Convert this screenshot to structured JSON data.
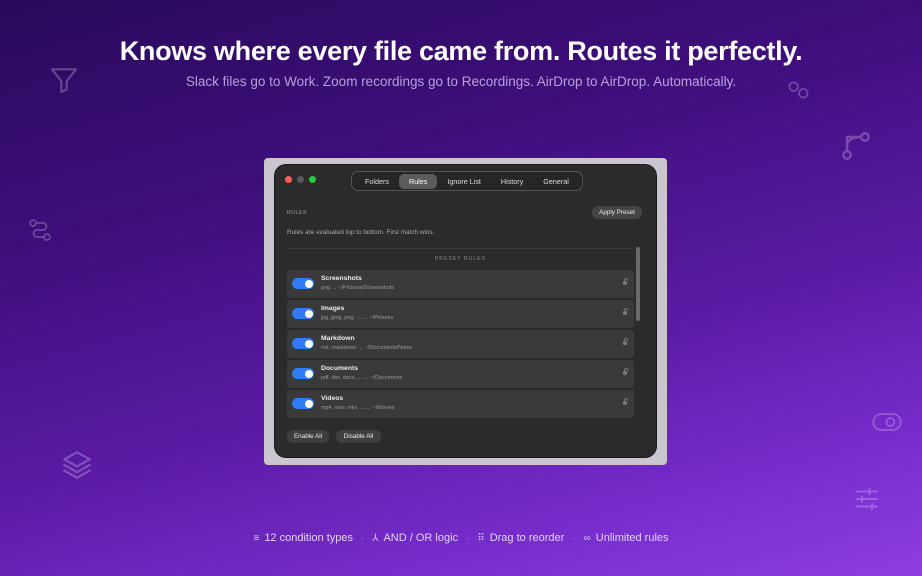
{
  "hero": {
    "title": "Knows where every file came from. Routes it perfectly.",
    "subtitle": "Slack files go to Work. Zoom recordings go to Recordings. AirDrop to AirDrop. Automatically."
  },
  "window": {
    "tabs": [
      {
        "label": "Folders"
      },
      {
        "label": "Rules",
        "active": true
      },
      {
        "label": "Ignore List"
      },
      {
        "label": "History"
      },
      {
        "label": "General"
      }
    ],
    "section_label": "RULES",
    "apply_preset_label": "Apply Preset",
    "description": "Rules are evaluated top to bottom. First match wins.",
    "preset_header": "PRESET RULES",
    "rules": [
      {
        "name": "Screenshots",
        "path": "png → ~/Pictures/Screenshots",
        "enabled": true
      },
      {
        "name": "Images",
        "path": "jpg, jpeg, png, ... → ~/Pictures",
        "enabled": true
      },
      {
        "name": "Markdown",
        "path": "md, markdown → ~/Documents/Notes",
        "enabled": true
      },
      {
        "name": "Documents",
        "path": "pdf, doc, docx, ... → ~/Documents",
        "enabled": true
      },
      {
        "name": "Videos",
        "path": "mp4, mov, mkv, ... → ~/Movies",
        "enabled": true
      }
    ],
    "enable_all_label": "Enable All",
    "disable_all_label": "Disable All"
  },
  "features": [
    {
      "icon": "filter-lines-icon",
      "label": "12 condition types"
    },
    {
      "icon": "merge-icon",
      "label": "AND / OR logic"
    },
    {
      "icon": "drag-handle-icon",
      "label": "Drag to reorder"
    },
    {
      "icon": "infinity-icon",
      "label": "Unlimited rules"
    }
  ],
  "colors": {
    "toggle_on": "#2f7cf6",
    "traffic_close": "#ff5f57",
    "traffic_min": "#5a5a5c",
    "traffic_max": "#28c840"
  }
}
